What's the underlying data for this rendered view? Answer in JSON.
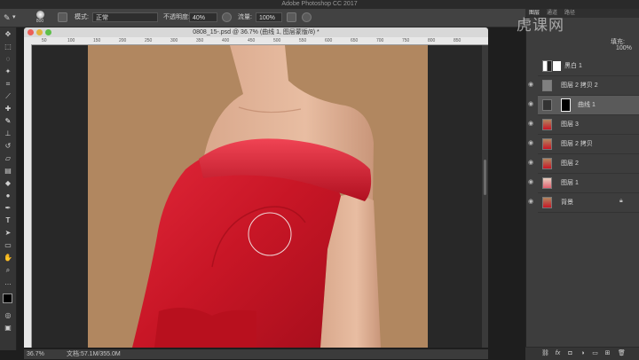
{
  "app": {
    "title": "Adobe Photoshop CC 2017"
  },
  "options": {
    "brush_size": "800",
    "mode_label": "模式:",
    "mode_value": "正常",
    "opacity_label": "不透明度:",
    "opacity_value": "40%",
    "flow_label": "流量:",
    "flow_value": "100%"
  },
  "document": {
    "title": "0808_15-.psd @ 36.7% (曲线 1, 图层蒙版/8) *",
    "zoom": "36.7%",
    "doc_size": "文档:57.1M/355.0M",
    "ruler_marks": [
      "50",
      "100",
      "150",
      "200",
      "250",
      "300",
      "350",
      "400",
      "450",
      "500",
      "550",
      "600",
      "650",
      "700",
      "750",
      "800",
      "850"
    ]
  },
  "panel": {
    "tabs": [
      "图层",
      "通道",
      "路径"
    ],
    "fill_label": "填充:",
    "fill_value": "100%",
    "opacity_short": "100%"
  },
  "layers": [
    {
      "name": "黑白 1",
      "type": "adjust"
    },
    {
      "name": "图层 2 拷贝 2",
      "type": "gray"
    },
    {
      "name": "曲线 1",
      "type": "curve"
    },
    {
      "name": "图层 3",
      "type": "photo"
    },
    {
      "name": "图层 2 拷贝",
      "type": "photo"
    },
    {
      "name": "图层 2",
      "type": "photo"
    },
    {
      "name": "图层 1",
      "type": "photo-light"
    },
    {
      "name": "背景",
      "type": "photo"
    }
  ],
  "watermark": "虎课网",
  "colors": {
    "accent_red": "#d01a2a",
    "background": "#b18760"
  }
}
